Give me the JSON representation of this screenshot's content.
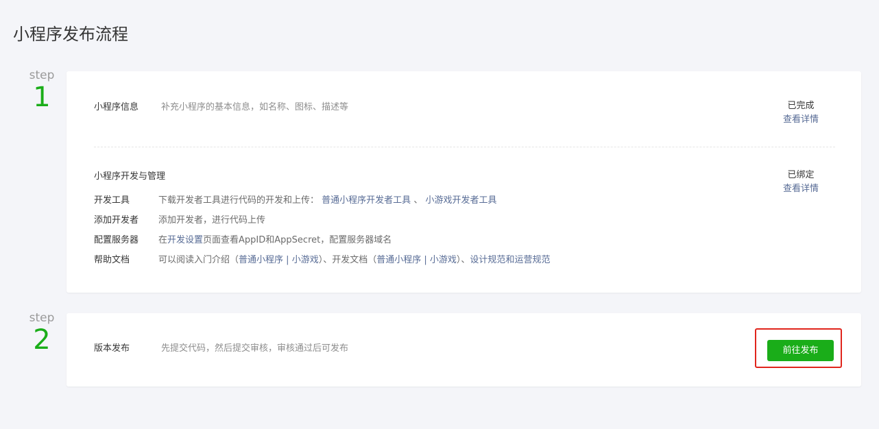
{
  "page": {
    "title": "小程序发布流程"
  },
  "steps": [
    {
      "word": "step",
      "number": "1"
    },
    {
      "word": "step",
      "number": "2"
    }
  ],
  "step1": {
    "info": {
      "label": "小程序信息",
      "desc": "补充小程序的基本信息，如名称、图标、描述等",
      "status": "已完成",
      "detail_link": "查看详情"
    },
    "dev": {
      "title": "小程序开发与管理",
      "status": "已绑定",
      "detail_link": "查看详情",
      "rows": {
        "tools": {
          "label": "开发工具",
          "desc": "下载开发者工具进行代码的开发和上传：",
          "link1": "普通小程序开发者工具",
          "sep": "、",
          "link2": "小游戏开发者工具"
        },
        "add_dev": {
          "label": "添加开发者",
          "desc": "添加开发者，进行代码上传"
        },
        "server": {
          "label": "配置服务器",
          "pre": "在",
          "link": "开发设置",
          "post": "页面查看AppID和AppSecret，配置服务器域名"
        },
        "docs": {
          "label": "帮助文档",
          "t1": "可以阅读入门介绍（",
          "l1": "普通小程序",
          "t2": " | ",
          "l2": "小游戏",
          "t3": "）、开发文档（",
          "l3": "普通小程序",
          "t4": " | ",
          "l4": "小游戏",
          "t5": "）、",
          "l5": "设计规范",
          "t6": "和",
          "l6": "运营规范"
        }
      }
    }
  },
  "step2": {
    "label": "版本发布",
    "desc": "先提交代码，然后提交审核，审核通过后可发布",
    "button": "前往发布"
  },
  "colors": {
    "accent_green": "#1aad19",
    "link_blue": "#576b95",
    "highlight_red": "#e0241b",
    "background": "#f4f5f9"
  }
}
